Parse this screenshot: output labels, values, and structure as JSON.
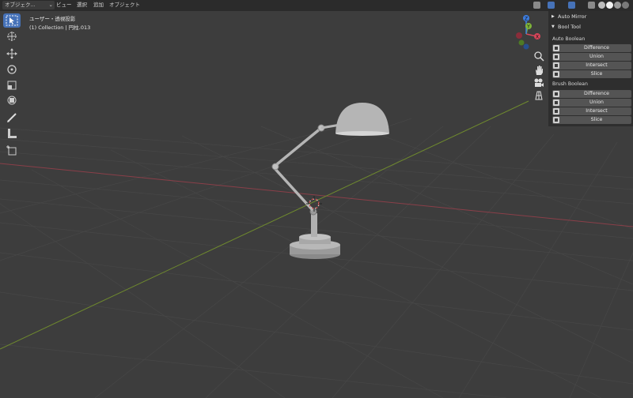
{
  "header": {
    "mode": "オブジェク...",
    "menus": [
      "ビュー",
      "選択",
      "追加",
      "オブジェクト"
    ]
  },
  "viewport": {
    "view_name": "ユーザー・透視投影",
    "collection_info": "(1) Collection | 円柱.013"
  },
  "gizmo": {
    "x": "X",
    "y": "Y",
    "z": "Z"
  },
  "panel": {
    "auto_mirror": "Auto Mirror",
    "bool_tool": "Bool Tool",
    "auto_boolean_label": "Auto Boolean",
    "auto_boolean_buttons": [
      "Difference",
      "Union",
      "Intersect",
      "Slice"
    ],
    "brush_boolean_label": "Brush Boolean",
    "brush_boolean_buttons": [
      "Difference",
      "Union",
      "Intersect",
      "Slice"
    ]
  },
  "colors": {
    "x_axis": "#8a3f49",
    "y_axis": "#6f8a2e",
    "active_tool": "#4672b8",
    "gizmo_x": "#d8465a",
    "gizmo_y": "#7fb53a",
    "gizmo_z": "#3d7de0"
  }
}
